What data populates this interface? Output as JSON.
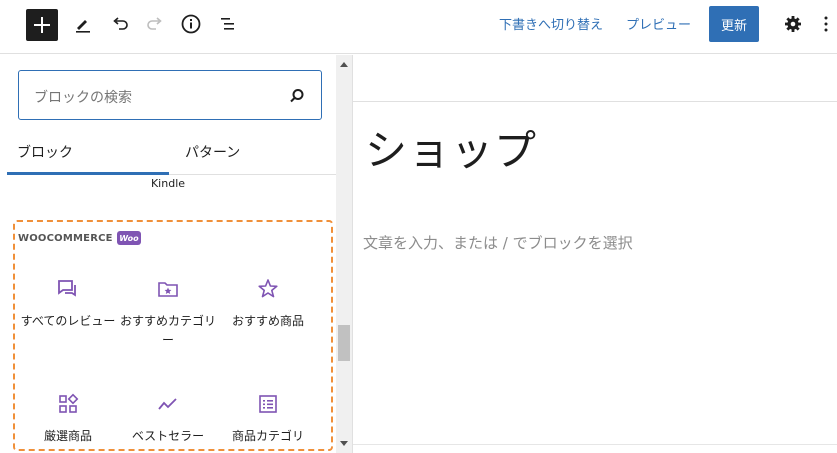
{
  "toolbar": {
    "add_icon": "plus-icon",
    "tools_icon": "pencil-icon",
    "undo_icon": "undo-icon",
    "redo_icon": "redo-icon",
    "details_icon": "info-icon",
    "outline_icon": "list-view-icon",
    "save_draft": "下書きへ切り替え",
    "preview": "プレビュー",
    "update": "更新",
    "settings_icon": "gear-icon",
    "more_icon": "more-vertical-icon"
  },
  "sidebar": {
    "search": {
      "placeholder": "ブロックの検索"
    },
    "tabs": [
      {
        "label": "ブロック",
        "active": true
      },
      {
        "label": "パターン",
        "active": false
      }
    ],
    "kindle_label": "Kindle",
    "woocommerce": {
      "heading": "WOOCOMMERCE",
      "badge": "Woo",
      "blocks": [
        {
          "label": "すべてのレビュー",
          "icon": "reviews-icon"
        },
        {
          "label": "おすすめカテゴリー",
          "icon": "folder-star-icon"
        },
        {
          "label": "おすすめ商品",
          "icon": "star-icon"
        },
        {
          "label": "厳選商品",
          "icon": "grid-icon"
        },
        {
          "label": "ベストセラー",
          "icon": "trend-icon"
        },
        {
          "label": "商品カテゴリ",
          "icon": "list-icon"
        }
      ]
    }
  },
  "editor": {
    "title": "ショップ",
    "placeholder": "文章を入力、または / でブロックを選択"
  },
  "colors": {
    "accent": "#2f6fb5",
    "woo_purple": "#7f54b3",
    "highlight": "#f0903a"
  }
}
